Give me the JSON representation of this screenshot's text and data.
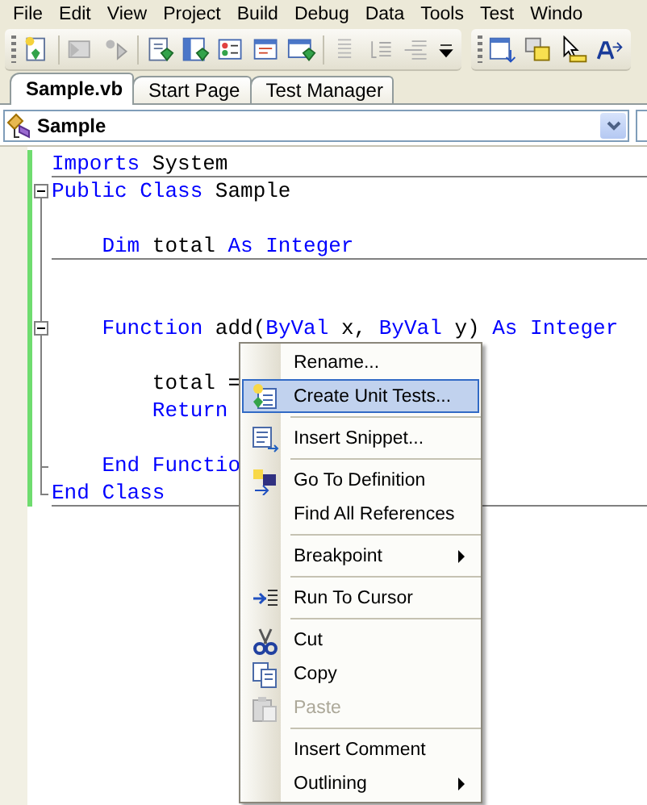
{
  "menu_bar": [
    "File",
    "Edit",
    "View",
    "Project",
    "Build",
    "Debug",
    "Data",
    "Tools",
    "Test",
    "Windo"
  ],
  "tabs": [
    {
      "label": "Sample.vb",
      "selected": true
    },
    {
      "label": "Start Page",
      "selected": false
    },
    {
      "label": "Test Manager",
      "selected": false
    }
  ],
  "navigation_bar": {
    "class_dropdown": "Sample"
  },
  "code_lines": [
    {
      "kind": "code",
      "rule_below": true,
      "tokens": [
        {
          "kind": "keyword",
          "text": "Imports"
        },
        {
          "kind": "plain",
          "text": " System"
        }
      ]
    },
    {
      "kind": "code",
      "collapsible": true,
      "tokens": [
        {
          "kind": "keyword",
          "text": "Public Class"
        },
        {
          "kind": "plain",
          "text": " Sample"
        }
      ]
    },
    {
      "kind": "blank"
    },
    {
      "kind": "code",
      "rule_below": true,
      "tokens": [
        {
          "kind": "keyword",
          "text": "    Dim"
        },
        {
          "kind": "plain",
          "text": " total "
        },
        {
          "kind": "keyword",
          "text": "As Integer"
        }
      ]
    },
    {
      "kind": "blank"
    },
    {
      "kind": "blank"
    },
    {
      "kind": "code",
      "collapsible": true,
      "tokens": [
        {
          "kind": "keyword",
          "text": "    Function"
        },
        {
          "kind": "plain",
          "text": " add("
        },
        {
          "kind": "keyword",
          "text": "ByVal"
        },
        {
          "kind": "plain",
          "text": " x, "
        },
        {
          "kind": "keyword",
          "text": "ByVal"
        },
        {
          "kind": "plain",
          "text": " y) "
        },
        {
          "kind": "keyword",
          "text": "As Integer"
        }
      ]
    },
    {
      "kind": "blank"
    },
    {
      "kind": "code",
      "tokens": [
        {
          "kind": "plain",
          "text": "        total ="
        }
      ]
    },
    {
      "kind": "code",
      "tokens": [
        {
          "kind": "keyword",
          "text": "        Return"
        }
      ]
    },
    {
      "kind": "blank"
    },
    {
      "kind": "code",
      "outline_end": true,
      "tokens": [
        {
          "kind": "keyword",
          "text": "    End Functio"
        }
      ]
    },
    {
      "kind": "code",
      "outline_end": true,
      "rule_below": true,
      "tokens": [
        {
          "kind": "keyword",
          "text": "End Class"
        }
      ]
    }
  ],
  "context_menu": [
    {
      "kind": "item",
      "label": "Rename...",
      "selected": false,
      "disabled": false,
      "submenu": false
    },
    {
      "kind": "item",
      "label": "Create Unit Tests...",
      "selected": true,
      "disabled": false,
      "submenu": false
    },
    {
      "kind": "separator"
    },
    {
      "kind": "item",
      "label": "Insert Snippet...",
      "selected": false,
      "disabled": false,
      "submenu": false
    },
    {
      "kind": "separator"
    },
    {
      "kind": "item",
      "label": "Go To Definition",
      "selected": false,
      "disabled": false,
      "submenu": false
    },
    {
      "kind": "item",
      "label": "Find All References",
      "selected": false,
      "disabled": false,
      "submenu": false
    },
    {
      "kind": "separator"
    },
    {
      "kind": "item",
      "label": "Breakpoint",
      "selected": false,
      "disabled": false,
      "submenu": true
    },
    {
      "kind": "separator"
    },
    {
      "kind": "item",
      "label": "Run To Cursor",
      "selected": false,
      "disabled": false,
      "submenu": false
    },
    {
      "kind": "separator"
    },
    {
      "kind": "item",
      "label": "Cut",
      "selected": false,
      "disabled": false,
      "submenu": false
    },
    {
      "kind": "item",
      "label": "Copy",
      "selected": false,
      "disabled": false,
      "submenu": false
    },
    {
      "kind": "item",
      "label": "Paste",
      "selected": false,
      "disabled": true,
      "submenu": false
    },
    {
      "kind": "separator"
    },
    {
      "kind": "item",
      "label": "Insert Comment",
      "selected": false,
      "disabled": false,
      "submenu": false
    },
    {
      "kind": "item",
      "label": "Outlining",
      "selected": false,
      "disabled": false,
      "submenu": true
    }
  ]
}
